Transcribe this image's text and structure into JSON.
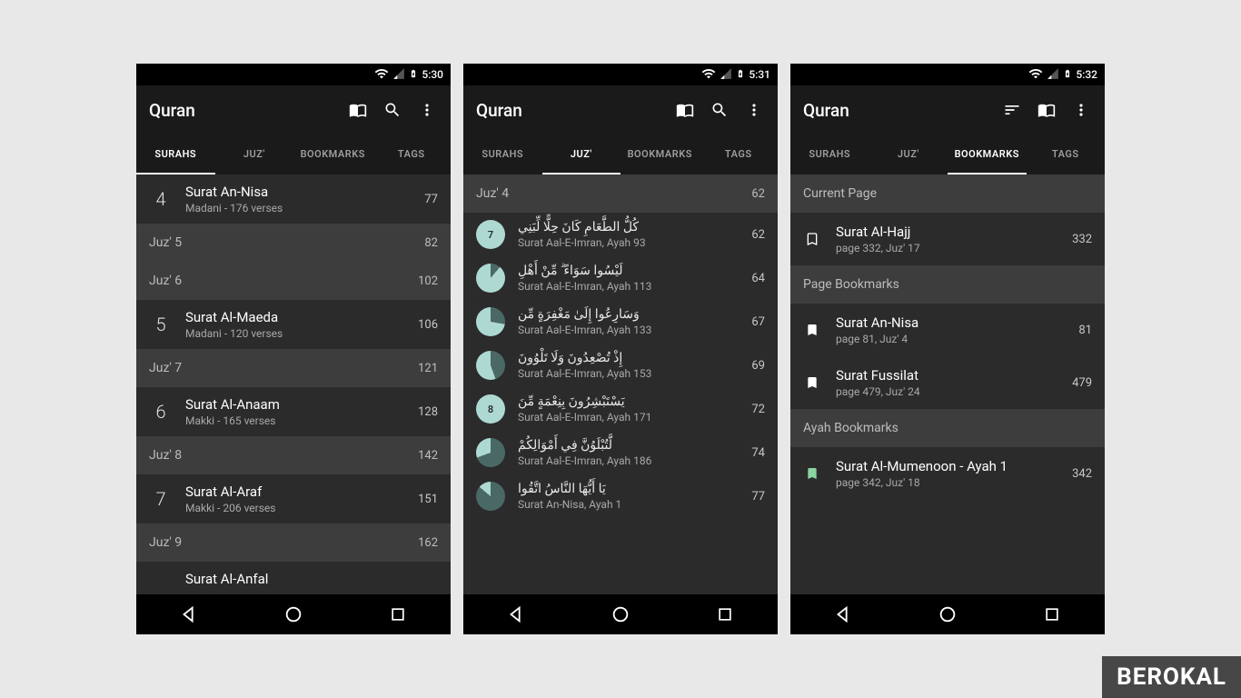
{
  "watermark": "BEROKAL",
  "app_title": "Quran",
  "tabs": [
    "SURAHS",
    "JUZ'",
    "BOOKMARKS",
    "TAGS"
  ],
  "phones": [
    {
      "time": "5:30",
      "active_tab": 0,
      "icons": [
        "book",
        "search",
        "more"
      ],
      "rows": [
        {
          "type": "surah",
          "num": "4",
          "name": "Surat An-Nisa",
          "sub": "Madani - 176 verses",
          "page": "77"
        },
        {
          "type": "hdr",
          "label": "Juz' 5",
          "page": "82"
        },
        {
          "type": "hdr",
          "label": "Juz' 6",
          "page": "102"
        },
        {
          "type": "surah",
          "num": "5",
          "name": "Surat Al-Maeda",
          "sub": "Madani - 120 verses",
          "page": "106"
        },
        {
          "type": "hdr",
          "label": "Juz' 7",
          "page": "121"
        },
        {
          "type": "surah",
          "num": "6",
          "name": "Surat Al-Anaam",
          "sub": "Makki - 165 verses",
          "page": "128"
        },
        {
          "type": "hdr",
          "label": "Juz' 8",
          "page": "142"
        },
        {
          "type": "surah",
          "num": "7",
          "name": "Surat Al-Araf",
          "sub": "Makki - 206 verses",
          "page": "151"
        },
        {
          "type": "hdr",
          "label": "Juz' 9",
          "page": "162"
        },
        {
          "type": "surah",
          "num": "",
          "name": "Surat Al-Anfal",
          "sub": "",
          "page": ""
        }
      ]
    },
    {
      "time": "5:31",
      "active_tab": 1,
      "icons": [
        "book",
        "search",
        "more"
      ],
      "rows": [
        {
          "type": "hdr",
          "label": "Juz' 4",
          "page": "62"
        },
        {
          "type": "ayah",
          "pie": "num",
          "pienum": "7",
          "ar": "كُلُّ الطَّعَامِ كَانَ حِلًّا لِّبَنِي",
          "sub": "Surat Aal-E-Imran, Ayah 93",
          "page": "62"
        },
        {
          "type": "ayah",
          "pie": "slice",
          "angle": 40,
          "ar": "لَيْسُوا سَوَاءً ۗ مِّنْ أَهْلِ",
          "sub": "Surat Aal-E-Imran, Ayah 113",
          "page": "64"
        },
        {
          "type": "ayah",
          "pie": "slice",
          "angle": 100,
          "ar": "وَسَارِعُوا إِلَىٰ مَغْفِرَةٍ مِّن",
          "sub": "Surat Aal-E-Imran, Ayah 133",
          "page": "67"
        },
        {
          "type": "ayah",
          "pie": "slice",
          "angle": 160,
          "ar": "إِذْ تُصْعِدُونَ وَلَا تَلْوُونَ",
          "sub": "Surat Aal-E-Imran, Ayah 153",
          "page": "69"
        },
        {
          "type": "ayah",
          "pie": "num",
          "pienum": "8",
          "ar": "يَسْتَبْشِرُونَ بِنِعْمَةٍ مِّنَ",
          "sub": "Surat Aal-E-Imran, Ayah 171",
          "page": "72"
        },
        {
          "type": "ayah",
          "pie": "slice",
          "angle": 250,
          "ar": "لَّتُبْلَوُنَّ فِي أَمْوَالِكُمْ",
          "sub": "Surat Aal-E-Imran, Ayah 186",
          "page": "74"
        },
        {
          "type": "ayah",
          "pie": "slice",
          "angle": 310,
          "ar": "يَا أَيُّهَا النَّاسُ اتَّقُوا",
          "sub": "Surat An-Nisa, Ayah 1",
          "page": "77"
        }
      ]
    },
    {
      "time": "5:32",
      "active_tab": 2,
      "icons": [
        "sort",
        "book",
        "more"
      ],
      "rows": [
        {
          "type": "hdr",
          "label": "Current Page",
          "page": ""
        },
        {
          "type": "bm",
          "icon": "bookmark-o",
          "name": "Surat Al-Hajj",
          "sub": "page 332, Juz' 17",
          "page": "332"
        },
        {
          "type": "hdr",
          "label": "Page Bookmarks",
          "page": ""
        },
        {
          "type": "bm",
          "icon": "bookmark",
          "name": "Surat An-Nisa",
          "sub": "page 81, Juz' 4",
          "page": "81"
        },
        {
          "type": "bm",
          "icon": "bookmark",
          "name": "Surat Fussilat",
          "sub": "page 479, Juz' 24",
          "page": "479"
        },
        {
          "type": "hdr",
          "label": "Ayah Bookmarks",
          "page": ""
        },
        {
          "type": "bm",
          "icon": "bookmark-g",
          "name": "Surat Al-Mumenoon - Ayah 1",
          "sub": "page 342, Juz' 18",
          "page": "342"
        }
      ]
    }
  ]
}
